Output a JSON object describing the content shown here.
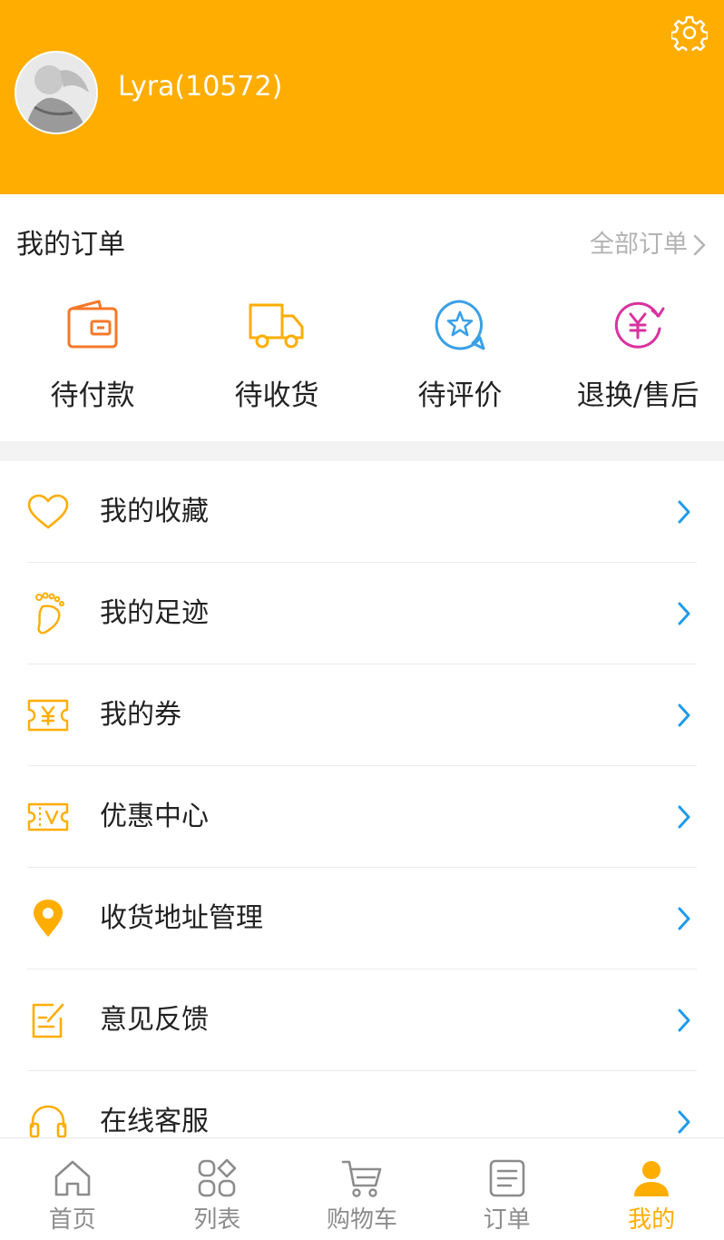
{
  "profile": {
    "username": "Lyra(10572)"
  },
  "orders": {
    "title": "我的订单",
    "all_label": "全部订单",
    "items": [
      {
        "label": "待付款",
        "icon": "wallet-icon"
      },
      {
        "label": "待收货",
        "icon": "truck-icon"
      },
      {
        "label": "待评价",
        "icon": "star-chat-icon"
      },
      {
        "label": "退换/售后",
        "icon": "yen-refund-icon"
      }
    ]
  },
  "menu": {
    "items": [
      {
        "label": "我的收藏",
        "icon": "heart-icon"
      },
      {
        "label": "我的足迹",
        "icon": "footprint-icon"
      },
      {
        "label": "我的券",
        "icon": "coupon-icon"
      },
      {
        "label": "优惠中心",
        "icon": "voucher-icon"
      },
      {
        "label": "收货地址管理",
        "icon": "location-pin-icon"
      },
      {
        "label": "意见反馈",
        "icon": "feedback-icon"
      },
      {
        "label": "在线客服",
        "icon": "headset-icon"
      }
    ]
  },
  "tabbar": {
    "items": [
      {
        "label": "首页",
        "icon": "home-icon"
      },
      {
        "label": "列表",
        "icon": "grid-icon"
      },
      {
        "label": "购物车",
        "icon": "cart-icon"
      },
      {
        "label": "订单",
        "icon": "order-list-icon"
      },
      {
        "label": "我的",
        "icon": "user-icon",
        "active": true
      }
    ]
  },
  "colors": {
    "brand": "#FFAD00",
    "order_pay": "#F5782A",
    "order_ship": "#FFAD00",
    "order_review": "#3AA0E6",
    "order_refund": "#D9329E",
    "chevron": "#1E9BEA",
    "menu_icon": "#FFAD00"
  }
}
